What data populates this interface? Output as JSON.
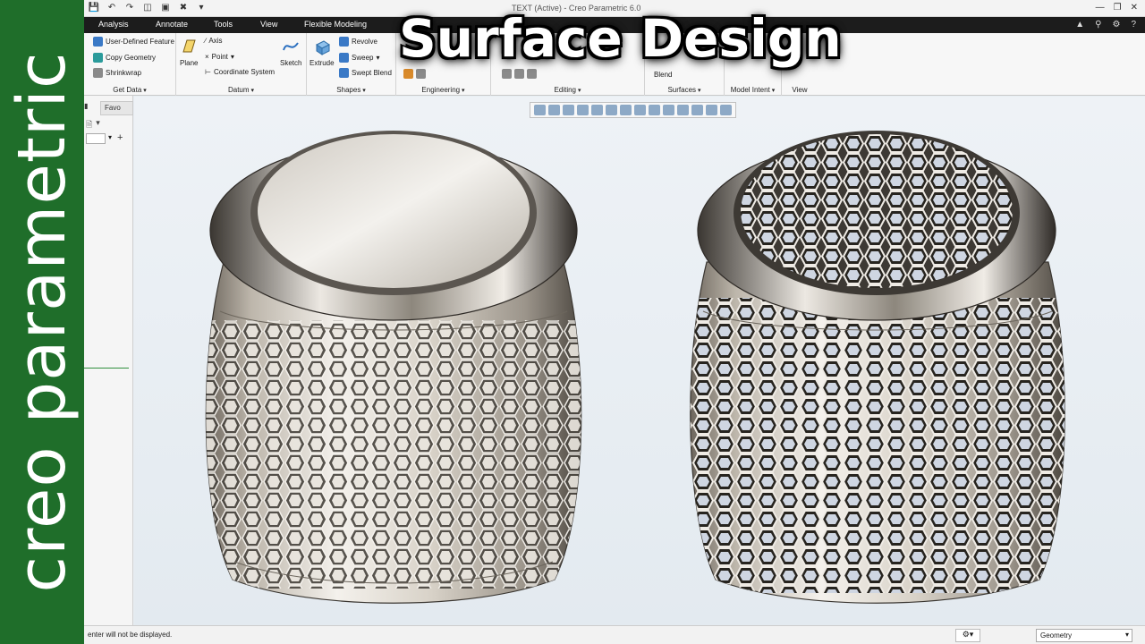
{
  "window": {
    "title": "TEXT (Active) - Creo Parametric 6.0"
  },
  "brand": {
    "text": "creo parametric",
    "color": "#1f6e2a"
  },
  "headline": "Surface Design",
  "tabs": [
    "Analysis",
    "Annotate",
    "Tools",
    "View",
    "Flexible Modeling"
  ],
  "ribbon": {
    "get_data": {
      "label": "Get Data",
      "items": [
        "User-Defined Feature",
        "Copy Geometry",
        "Shrinkwrap"
      ]
    },
    "datum": {
      "label": "Datum",
      "plane": "Plane",
      "axis": "Axis",
      "point": "Point",
      "csys": "Coordinate System",
      "sketch": "Sketch"
    },
    "shapes": {
      "label": "Shapes",
      "extrude": "Extrude",
      "revolve": "Revolve",
      "sweep": "Sweep",
      "swept_blend": "Swept Blend"
    },
    "engineering": {
      "label": "Engineering"
    },
    "editing": {
      "label": "Editing"
    },
    "surfaces": {
      "label": "Surfaces",
      "blend": "Blend"
    },
    "model_intent": {
      "label": "Model Intent"
    },
    "view": {
      "label": "View"
    }
  },
  "model_tree": {
    "fav_tab": "Favo"
  },
  "status": {
    "message": "enter will not be displayed.",
    "filter": "Geometry"
  },
  "icons": [
    "save-icon",
    "undo-icon",
    "redo-icon",
    "regenerate-icon",
    "windows-icon",
    "close-icon",
    "zoom-in-icon",
    "zoom-out-icon",
    "refit-icon",
    "help-icon"
  ],
  "colors": {
    "ribbon_tabs_bg": "#1c1c1c",
    "model_metal": "#d8d2c8",
    "viewport_bg": "#e6ecf1"
  }
}
